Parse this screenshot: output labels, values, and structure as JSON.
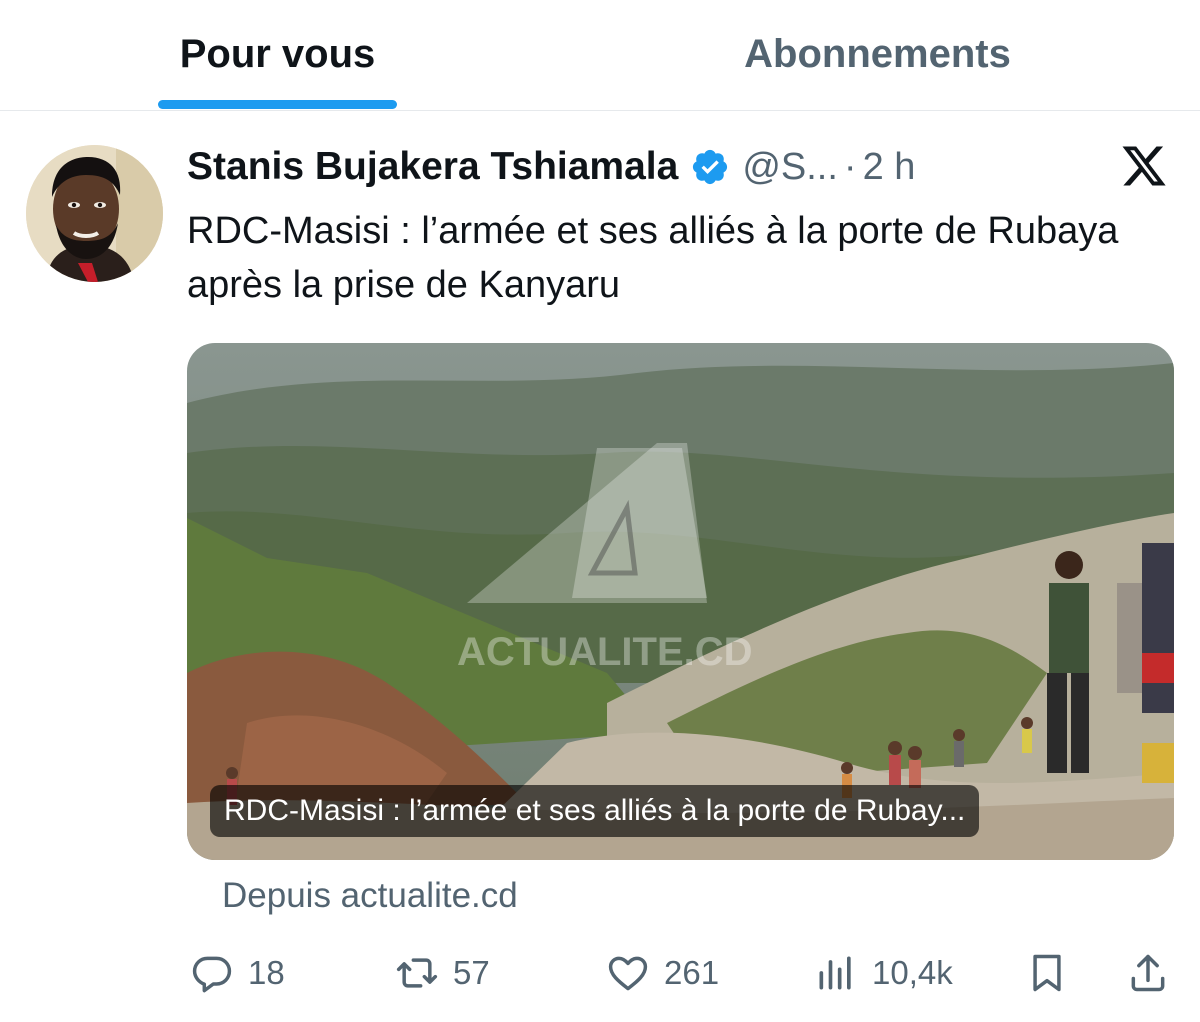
{
  "tabs": [
    {
      "label": "Pour vous",
      "active": true
    },
    {
      "label": "Abonnements",
      "active": false
    }
  ],
  "tweet": {
    "author_name": "Stanis Bujakera Tshiamala",
    "handle": "@S...",
    "separator": "·",
    "time": "2 h",
    "text": "RDC-Masisi : l’armée et ses alliés à la porte de Rubaya après la prise de Kanyaru",
    "card": {
      "caption": "RDC-Masisi : l’armée et ses alliés à la porte de Rubay...",
      "watermark": "ACTUALITE.CD"
    },
    "source": "Depuis actualite.cd",
    "stats": {
      "replies": "18",
      "reposts": "57",
      "likes": "261",
      "views": "10,4k"
    }
  },
  "icons": {
    "verified": "verified-badge-icon",
    "x_logo": "x-logo-icon",
    "reply": "reply-icon",
    "repost": "repost-icon",
    "like": "heart-icon",
    "views": "views-chart-icon",
    "bookmark": "bookmark-icon",
    "share": "share-icon"
  },
  "colors": {
    "accent": "#1d9bf0",
    "text_primary": "#0f1419",
    "text_secondary": "#536471"
  }
}
